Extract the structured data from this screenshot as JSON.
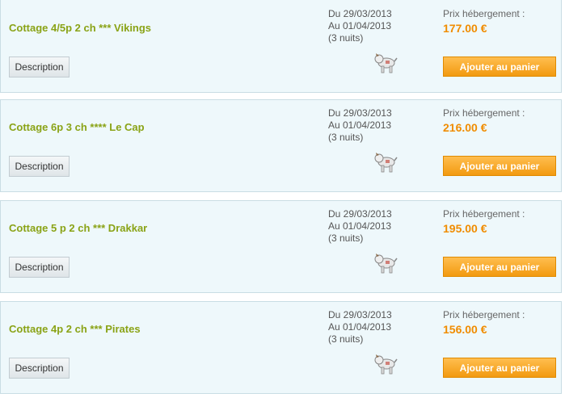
{
  "listings": [
    {
      "title": "Cottage 4/5p 2 ch *** Vikings",
      "description_label": "Description",
      "date_from": "Du 29/03/2013",
      "date_to": "Au 01/04/2013",
      "nights": "(3 nuits)",
      "price_label": "Prix hébergement :",
      "price": "177.00 €",
      "add_label": "Ajouter au panier",
      "pet_icon": "dog-icon"
    },
    {
      "title": "Cottage 6p 3 ch **** Le Cap",
      "description_label": "Description",
      "date_from": "Du 29/03/2013",
      "date_to": "Au 01/04/2013",
      "nights": "(3 nuits)",
      "price_label": "Prix hébergement :",
      "price": "216.00 €",
      "add_label": "Ajouter au panier",
      "pet_icon": "dog-icon"
    },
    {
      "title": "Cottage 5 p 2 ch *** Drakkar",
      "description_label": "Description",
      "date_from": "Du 29/03/2013",
      "date_to": "Au 01/04/2013",
      "nights": "(3 nuits)",
      "price_label": "Prix hébergement :",
      "price": "195.00 €",
      "add_label": "Ajouter au panier",
      "pet_icon": "dog-icon"
    },
    {
      "title": "Cottage 4p 2 ch *** Pirates",
      "description_label": "Description",
      "date_from": "Du 29/03/2013",
      "date_to": "Au 01/04/2013",
      "nights": "(3 nuits)",
      "price_label": "Prix hébergement :",
      "price": "156.00 €",
      "add_label": "Ajouter au panier",
      "pet_icon": "dog-icon"
    }
  ],
  "colors": {
    "card_bg": "#eef8fb",
    "title": "#8aa316",
    "price": "#f08c00",
    "add_button": "#f29a10"
  }
}
